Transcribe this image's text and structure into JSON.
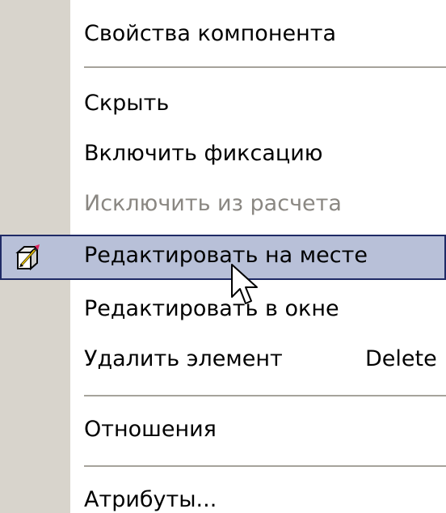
{
  "menu": {
    "items": [
      {
        "label": "Свойства компонента",
        "state": "normal"
      },
      {
        "label": "Скрыть",
        "state": "normal"
      },
      {
        "label": "Включить фиксацию",
        "state": "normal"
      },
      {
        "label": "Исключить из расчета",
        "state": "disabled"
      },
      {
        "label": "Редактировать на месте",
        "state": "highlighted",
        "icon": "edit-in-place-cube-pencil-icon"
      },
      {
        "label": "Редактировать в окне",
        "state": "normal"
      },
      {
        "label": "Удалить элемент",
        "shortcut": "Delete",
        "state": "normal"
      },
      {
        "label": "Отношения",
        "state": "normal"
      },
      {
        "label": "Атрибуты...",
        "state": "normal"
      }
    ]
  },
  "colors": {
    "gutter": "#d8d4cc",
    "highlight_bg": "#b8c0d8",
    "highlight_border": "#1f2a66",
    "disabled_text": "#8a8782"
  },
  "cursor": {
    "icon": "mouse-pointer-icon"
  }
}
